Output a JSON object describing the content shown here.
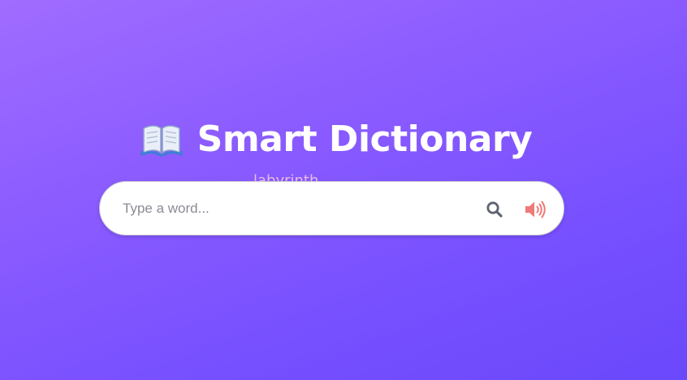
{
  "header": {
    "icon": "open-book-icon",
    "title": "Smart Dictionary"
  },
  "ghost_word": "labyrinth",
  "search": {
    "placeholder": "Type a word...",
    "value": "",
    "search_icon": "search-icon",
    "speaker_icon": "speaker-icon"
  },
  "colors": {
    "background_start": "#a06cff",
    "background_end": "#6a48fb",
    "title": "#ffffff",
    "search_icon": "#5f6470",
    "speaker_icon": "#ee7a7a"
  }
}
